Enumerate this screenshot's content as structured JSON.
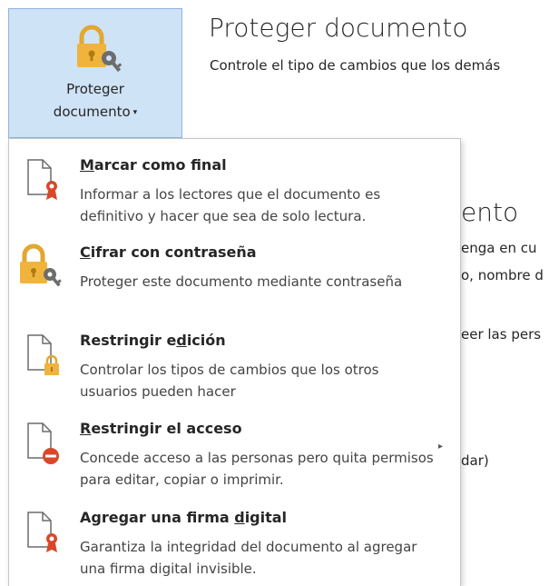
{
  "button": {
    "line1": "Proteger",
    "line2": "documento",
    "caret": "▾"
  },
  "background": {
    "title": "Proteger documento",
    "subtitle": "Controle el tipo de cambios que los demás",
    "fragments": [
      "ento",
      "enga en cu",
      "o, nombre d",
      "eer las pers",
      "dar)"
    ]
  },
  "menu": {
    "items": [
      {
        "t1": "",
        "tu": "M",
        "t2": "arcar como final",
        "desc": "Informar a los lectores que el documento es definitivo y hacer que sea de solo lectura.",
        "icon": "document-ribbon-icon"
      },
      {
        "t1": "",
        "tu": "C",
        "t2": "ifrar con contraseña",
        "desc": "Proteger este documento mediante contraseña",
        "icon": "lock-key-icon"
      },
      {
        "t1": "Restringir e",
        "tu": "d",
        "t2": "ición",
        "desc": "Controlar los tipos de cambios que los otros usuarios pueden hacer",
        "icon": "document-lock-icon"
      },
      {
        "t1": "",
        "tu": "R",
        "t2": "estringir el acceso",
        "desc": "Concede acceso a las personas pero quita permisos para editar, copiar o imprimir.",
        "icon": "document-restricted-icon",
        "arrow": "▸"
      },
      {
        "t1": "Agregar una firma ",
        "tu": "d",
        "t2": "igital",
        "desc": "Garantiza la integridad del documento al agregar una firma digital invisible.",
        "icon": "document-signature-icon"
      }
    ]
  }
}
